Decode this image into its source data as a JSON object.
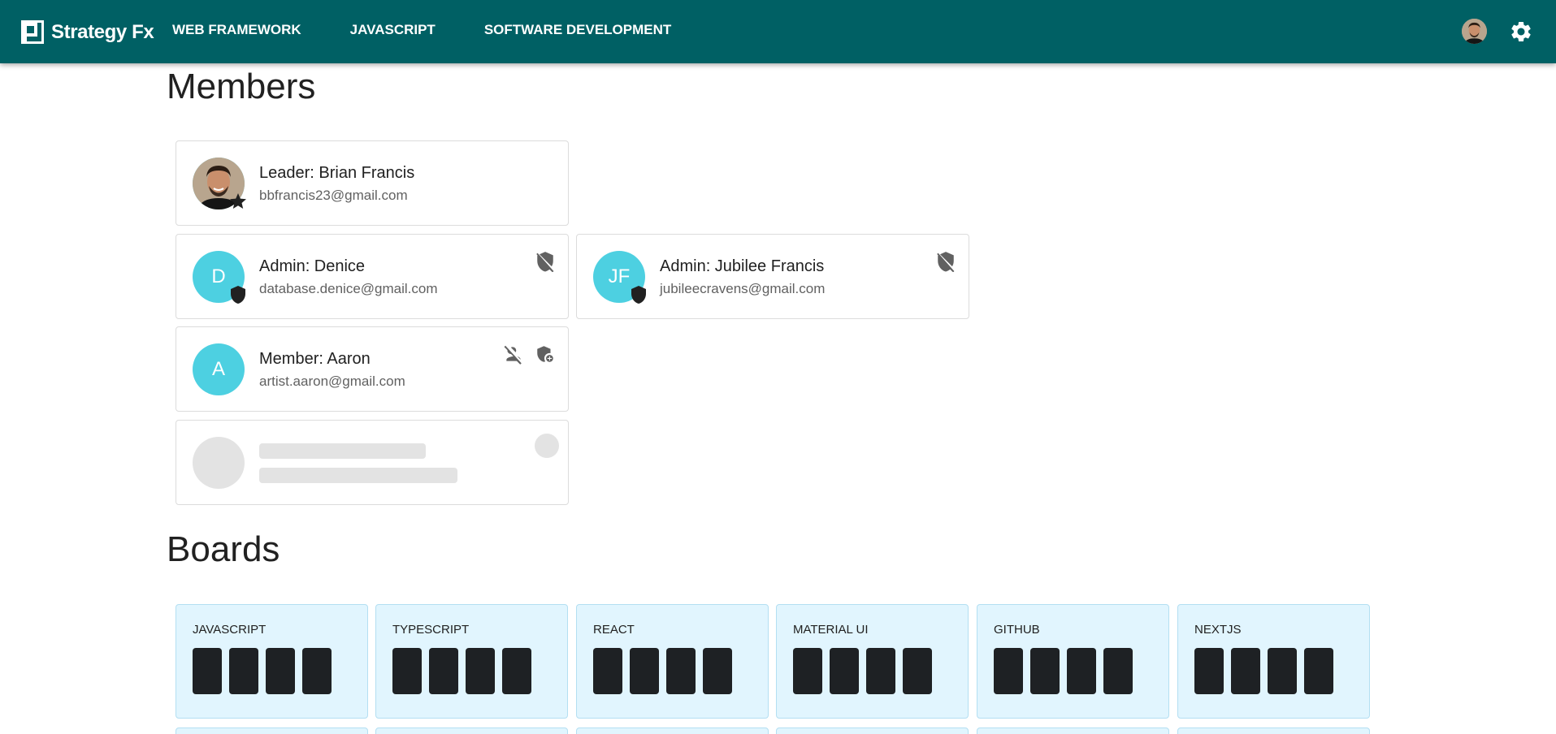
{
  "app": {
    "name": "Strategy Fx",
    "nav": [
      "WEB FRAMEWORK",
      "JAVASCRIPT",
      "SOFTWARE DEVELOPMENT"
    ],
    "icons": {
      "logo": "strategy-fx-logo-icon",
      "settings": "gear-icon",
      "profile": "user-avatar"
    },
    "colors": {
      "appbar": "#006064",
      "avatar": "#4dd0e1",
      "board": "#e1f5fe",
      "board_column": "#1e2124",
      "skeleton": "#e3e3e3"
    }
  },
  "members": {
    "title": "Members",
    "leader": {
      "label": "Leader: Brian Francis",
      "email": "bbfrancis23@gmail.com",
      "badge": "star-icon"
    },
    "admins": [
      {
        "initials": "D",
        "label": "Admin: Denice",
        "email": "database.denice@gmail.com",
        "badge": "shield-icon",
        "action": "remove-admin-icon"
      },
      {
        "initials": "JF",
        "label": "Admin: Jubilee Francis",
        "email": "jubileecravens@gmail.com",
        "badge": "shield-icon",
        "action": "remove-admin-icon"
      }
    ],
    "member": {
      "initials": "A",
      "label": "Member: Aaron",
      "email": "artist.aaron@gmail.com",
      "actions": [
        "remove-member-icon",
        "make-admin-icon"
      ]
    },
    "placeholder": "loading-skeleton"
  },
  "boards": {
    "title": "Boards",
    "items": [
      {
        "title": "JAVASCRIPT",
        "columns": 4
      },
      {
        "title": "TYPESCRIPT",
        "columns": 4
      },
      {
        "title": "REACT",
        "columns": 4
      },
      {
        "title": "MATERIAL UI",
        "columns": 4
      },
      {
        "title": "GITHUB",
        "columns": 4
      },
      {
        "title": "NEXTJS",
        "columns": 4
      }
    ]
  }
}
